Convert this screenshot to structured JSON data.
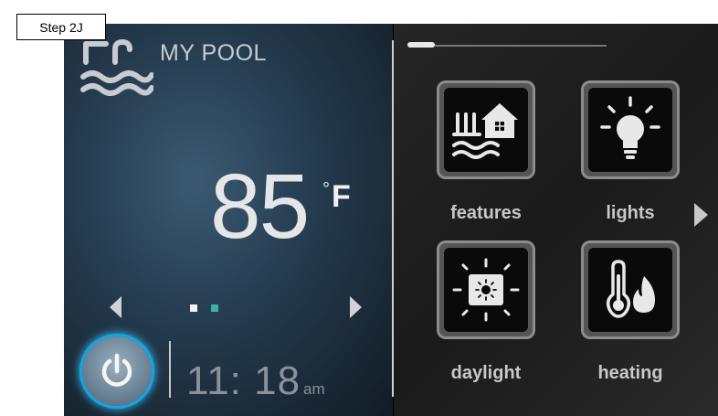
{
  "step_label": "Step 2J",
  "header": {
    "title": "MY POOL"
  },
  "temperature": {
    "value": "85",
    "degree": "°",
    "unit": "F"
  },
  "pager": {
    "pages": 2,
    "active": 1
  },
  "clock": {
    "time": "11: 18",
    "ampm": "am"
  },
  "tiles": [
    {
      "label": "features",
      "icon": "features-icon"
    },
    {
      "label": "lights",
      "icon": "light-bulb-icon"
    },
    {
      "label": "daylight",
      "icon": "daylight-icon"
    },
    {
      "label": "heating",
      "icon": "thermometer-flame-icon"
    }
  ],
  "colors": {
    "power_ring": "#13a6e6",
    "active_dot": "#3ab3a6"
  }
}
